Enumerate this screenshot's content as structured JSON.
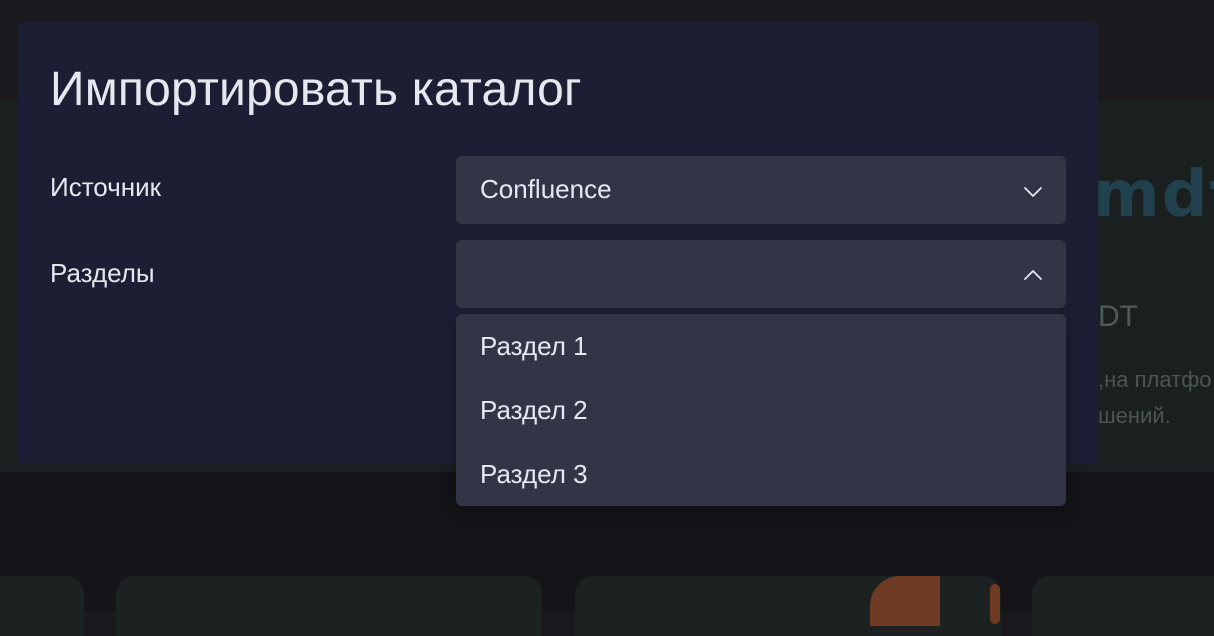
{
  "background": {
    "logo_text": "mdt",
    "heading": "DT",
    "description_lines": [
      ",на платфо",
      "шений."
    ]
  },
  "modal": {
    "title": "Импортировать каталог",
    "fields": {
      "source": {
        "label": "Источник",
        "value": "Confluence",
        "state": "collapsed"
      },
      "sections": {
        "label": "Разделы",
        "value": "",
        "state": "expanded",
        "options": [
          "Раздел 1",
          "Раздел 2",
          "Раздел 3"
        ]
      }
    }
  },
  "colors": {
    "modal_bg": "#1c1f33",
    "control_bg": "#333547",
    "text": "#e6e7ef",
    "page_bg": "#18181d"
  },
  "icons": {
    "source_chevron": "chevron-down-icon",
    "sections_chevron": "chevron-up-icon"
  }
}
